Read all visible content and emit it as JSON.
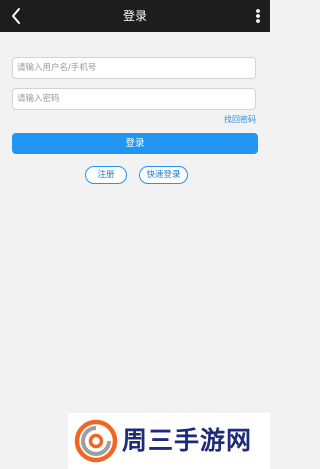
{
  "header": {
    "title": "登录",
    "back_icon": "chevron-left-icon",
    "more_icon": "more-vertical-icon",
    "background": "#1d1d1d"
  },
  "form": {
    "username_placeholder": "请输入用户名/手机号",
    "password_placeholder": "请输入密码",
    "forgot_password": "找回密码",
    "login_button": "登录",
    "register_button": "注册",
    "quick_login_button": "快速登录"
  },
  "watermark": {
    "text": "周三手游网"
  },
  "colors": {
    "accent": "#2196f3",
    "link": "#2a8de8",
    "page_background": "#f2f2f2",
    "watermark_text": "#1e2b7b",
    "watermark_logo_orange": "#f26522",
    "watermark_logo_grey": "#9e9e9e"
  }
}
